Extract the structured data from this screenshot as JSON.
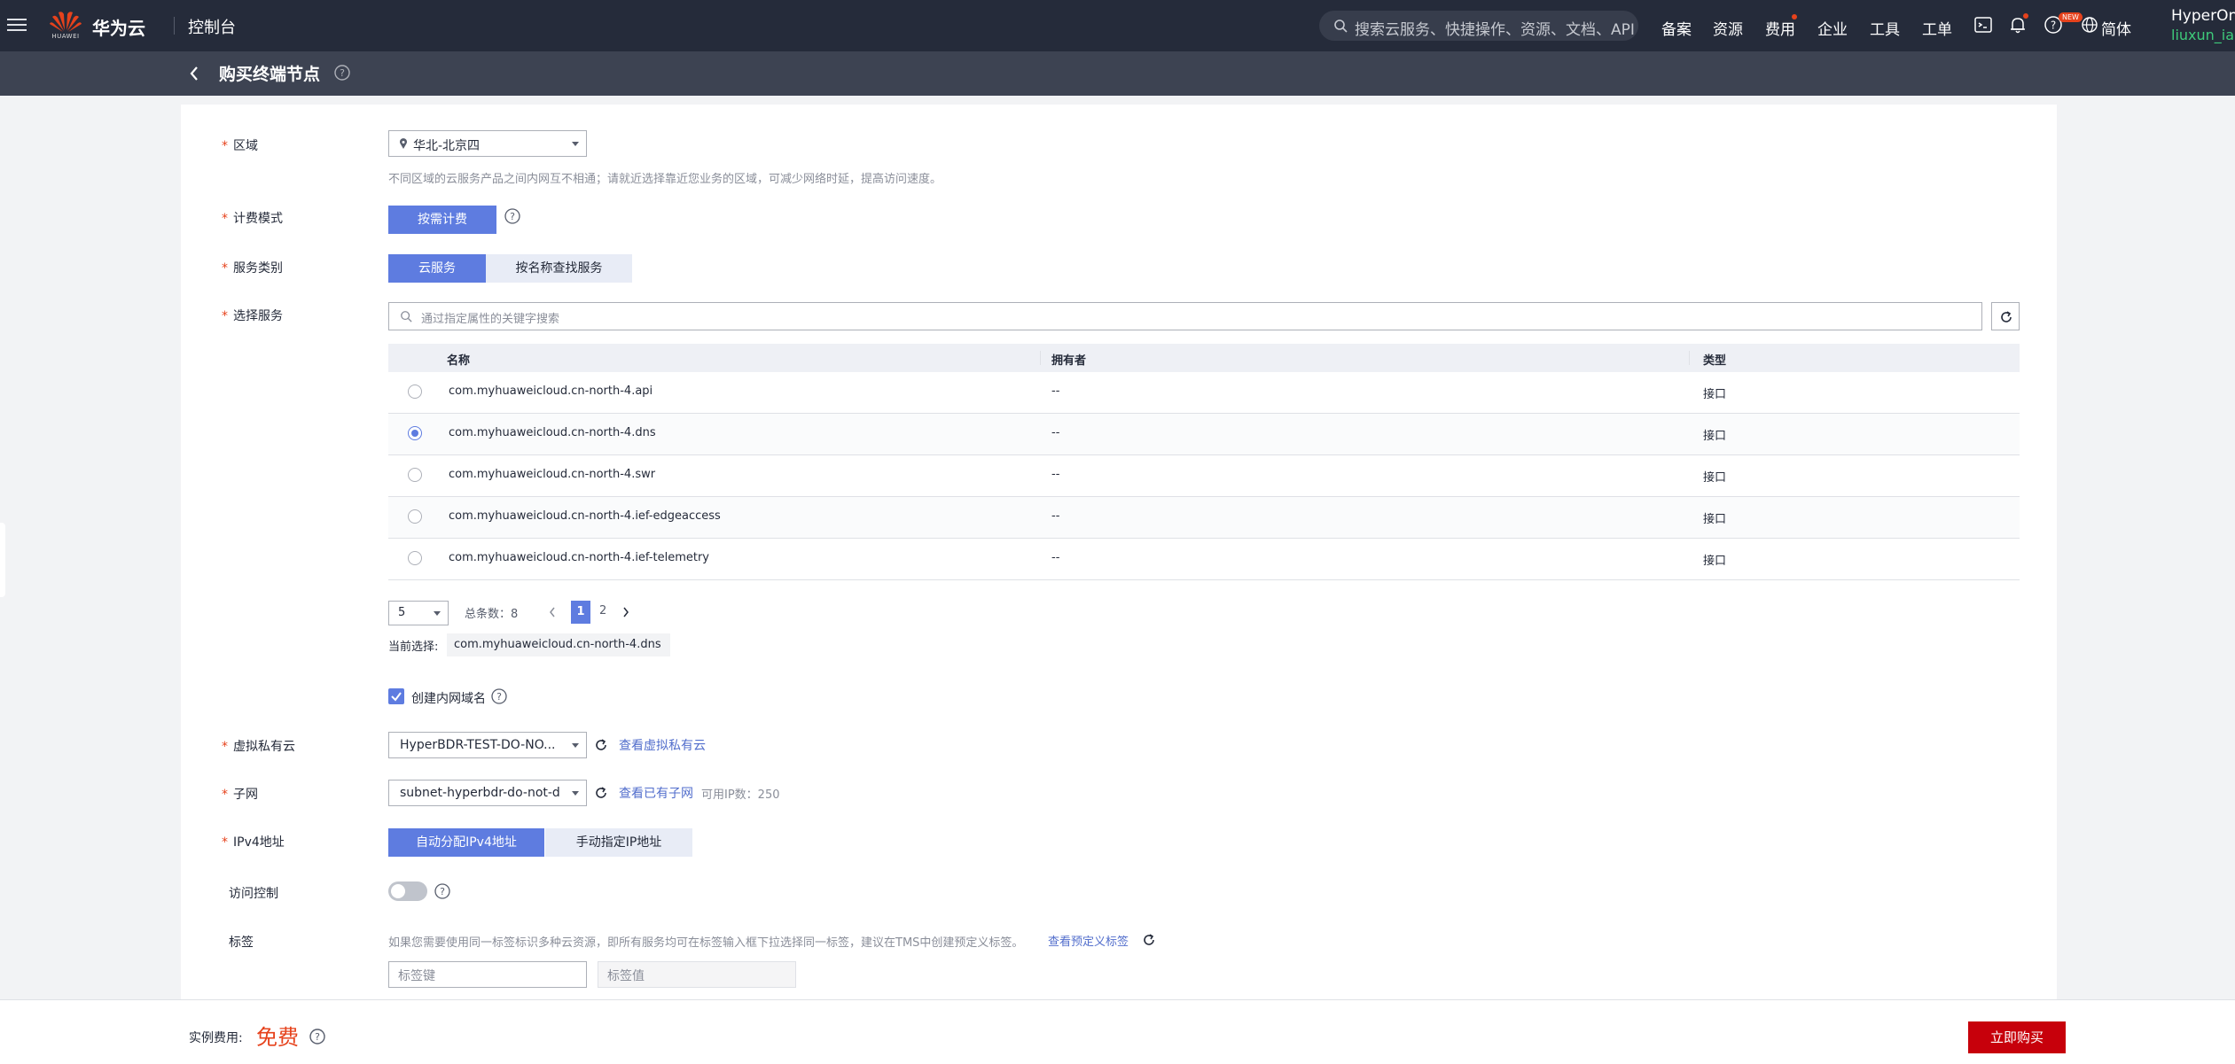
{
  "topbar": {
    "logo_text": "HUAWEI",
    "brand": "华为云",
    "console": "控制台",
    "search_placeholder": "搜索云服务、快捷操作、资源、文档、API",
    "nav": [
      "备案",
      "资源",
      "费用",
      "企业",
      "工具",
      "工单"
    ],
    "lang": "简体",
    "new_badge": "NEW",
    "user_name": "HyperOne",
    "user_sub": "liuxun_iam"
  },
  "subhead": {
    "title": "购买终端节点"
  },
  "form": {
    "region": {
      "label": "区域",
      "value": "华北-北京四",
      "hint": "不同区域的云服务产品之间内网互不相通；请就近选择靠近您业务的区域，可减少网络时延，提高访问速度。"
    },
    "billing": {
      "label": "计费模式",
      "option": "按需计费"
    },
    "service_type": {
      "label": "服务类别",
      "options": [
        "云服务",
        "按名称查找服务"
      ]
    },
    "select_service": {
      "label": "选择服务",
      "search_placeholder": "通过指定属性的关键字搜索",
      "columns": [
        "名称",
        "拥有者",
        "类型"
      ],
      "rows": [
        {
          "name": "com.myhuaweicloud.cn-north-4.api",
          "owner": "--",
          "type": "接口",
          "selected": false
        },
        {
          "name": "com.myhuaweicloud.cn-north-4.dns",
          "owner": "--",
          "type": "接口",
          "selected": true
        },
        {
          "name": "com.myhuaweicloud.cn-north-4.swr",
          "owner": "--",
          "type": "接口",
          "selected": false
        },
        {
          "name": "com.myhuaweicloud.cn-north-4.ief-edgeaccess",
          "owner": "--",
          "type": "接口",
          "selected": false
        },
        {
          "name": "com.myhuaweicloud.cn-north-4.ief-telemetry",
          "owner": "--",
          "type": "接口",
          "selected": false
        }
      ],
      "page_size": "5",
      "total_label": "总条数：8",
      "pages": [
        "1",
        "2"
      ],
      "current_label": "当前选择:",
      "current_value": "com.myhuaweicloud.cn-north-4.dns"
    },
    "create_domain": {
      "label": "创建内网域名",
      "checked": true
    },
    "vpc": {
      "label": "虚拟私有云",
      "value": "HyperBDR-TEST-DO-NO...",
      "link": "查看虚拟私有云"
    },
    "subnet": {
      "label": "子网",
      "value": "subnet-hyperbdr-do-not-d...",
      "link": "查看已有子网",
      "available": "可用IP数：250"
    },
    "ipv4": {
      "label": "IPv4地址",
      "options": [
        "自动分配IPv4地址",
        "手动指定IP地址"
      ]
    },
    "access_control": {
      "label": "访问控制"
    },
    "tags": {
      "label": "标签",
      "hint": "如果您需要使用同一标签标识多种云资源，即所有服务均可在标签输入框下拉选择同一标签，建议在TMS中创建预定义标签。",
      "link": "查看预定义标签",
      "key_placeholder": "标签键",
      "value_placeholder": "标签值"
    }
  },
  "bottom": {
    "fee_label": "实例费用:",
    "fee_value": "免费",
    "buy_label": "立即购买"
  },
  "colors": {
    "primary": "#5e7ce0",
    "danger": "#c7000b",
    "topbar": "#252b3a"
  }
}
